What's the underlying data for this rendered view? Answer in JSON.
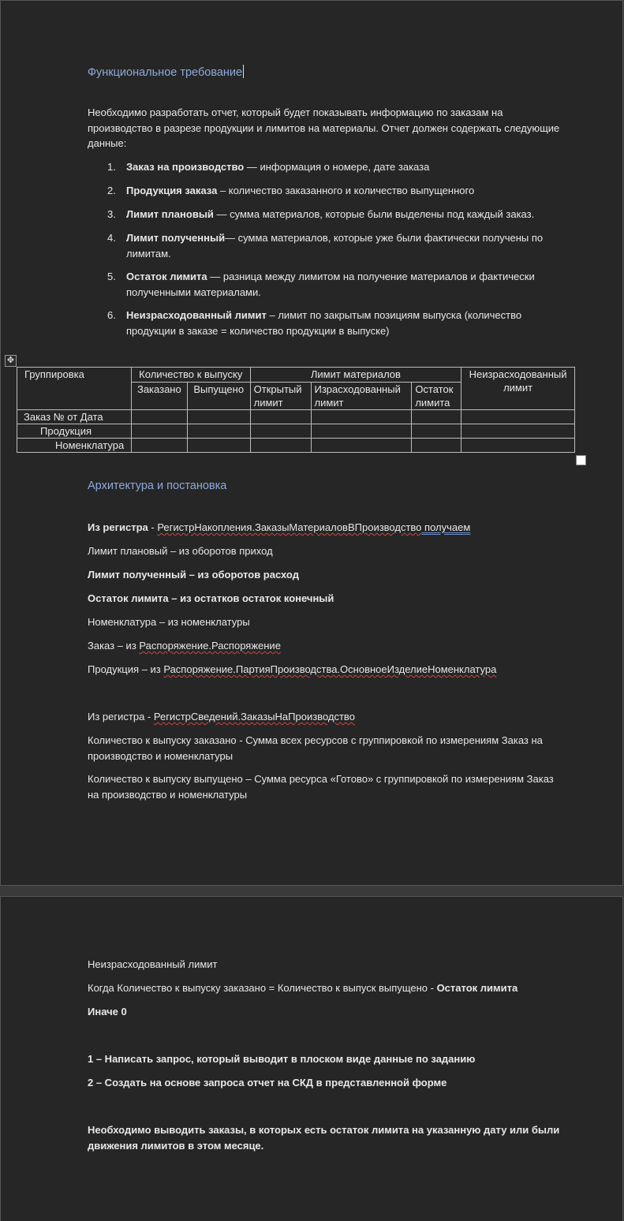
{
  "section1": {
    "heading": "Функциональное требование",
    "intro_line1": "Необходимо разработать отчет, который будет показывать информацию по заказам на",
    "intro_line2": "производство в разрезе продукции и лимитов на материалы. Отчет должен содержать следующие",
    "intro_line3": "данные:",
    "items": [
      {
        "num": "1.",
        "bold": "Заказ на производство",
        "rest": " — информация о номере, дате заказа",
        "rest2": ""
      },
      {
        "num": "2.",
        "bold": "Продукция заказа",
        "rest": " – количество заказанного и количество выпущенного",
        "rest2": ""
      },
      {
        "num": "3.",
        "bold": "Лимит плановый",
        "rest": " — сумма материалов, которые были выделены под каждый заказ.",
        "rest2": ""
      },
      {
        "num": "4.",
        "bold": "Лимит полученный",
        "rest": "— сумма материалов, которые уже были фактически получены по",
        "rest2": "лимитам."
      },
      {
        "num": "5.",
        "bold": "Остаток лимита",
        "rest": " — разница между лимитом на получение материалов и фактически",
        "rest2": "полученными материалами."
      },
      {
        "num": "6.",
        "bold": "Неизрасходованный лимит",
        "rest": " – лимит по закрытым позициям выпуска (количество",
        "rest2": "продукции в заказе = количество продукции в выпуске)"
      }
    ]
  },
  "table": {
    "col_group": "Группировка",
    "qty_header": "Количество к выпуску",
    "qty_ordered": "Заказано",
    "qty_released": "Выпущено",
    "limit_header": "Лимит материалов",
    "limit_open_1": "Открытый",
    "limit_open_2": "лимит",
    "limit_spent_1": "Израсходованный",
    "limit_spent_2": "лимит",
    "limit_rest_1": "Остаток",
    "limit_rest_2": "лимита",
    "unspent_1": "Неизрасходованный",
    "unspent_2": "лимит",
    "row1": "Заказ № от Дата",
    "row2": "Продукция",
    "row3": "Номенклатура"
  },
  "section2": {
    "heading": "Архитектура и постановка",
    "reg1_bold": "Из регистра",
    "reg1_dash": " - ",
    "reg1_name": "РегистрНакопления.ЗаказыМатериаловВПроизводство",
    "reg1_space": " ",
    "reg1_tail": " получаем",
    "plan": "Лимит плановый – из оборотов приход",
    "recv_bold": "Лимит полученный",
    "recv_rest": " – из оборотов расход",
    "rest_bold": "Остаток лимита",
    "rest_rest": " – из остатков остаток конечный",
    "nomen": "Номенклатура – из номенклатуры",
    "order_prefix": "Заказ – из ",
    "order_name": "Распоряжение.Распоряжение",
    "prod_prefix": "Продукция – из ",
    "prod_name": "Распоряжение.ПартияПроизводства.ОсновноеИзделиеНоменклатура",
    "reg2_prefix": "Из регистра - ",
    "reg2_name": "РегистрСведений.ЗаказыНаПроизводство",
    "qty1_l1": "Количество к выпуску заказано - Сумма всех ресурсов с группировкой по измерениям Заказ на",
    "qty1_l2": "производство и номенклатуры",
    "qty2_l1": "Количество к выпуску выпущено – Сумма ресурса «Готово» с группировкой по измерениям Заказ",
    "qty2_l2": "на производство и номенклатуры"
  },
  "section3": {
    "unspent": "Неизрасходованный лимит",
    "when_text": "Когда Количество к выпуску заказано = Количество к выпуск выпущено - ",
    "when_bold": "Остаток лимита",
    "else": "Иначе 0",
    "task1": "1 – Написать запрос, который выводит в плоском виде данные по заданию",
    "task2": "2 – Создать на основе запроса отчет на СКД в представленной форме",
    "final_l1": "Необходимо выводить заказы, в которых есть остаток лимита на указанную дату или были",
    "final_l2": "движения лимитов в этом месяце."
  }
}
